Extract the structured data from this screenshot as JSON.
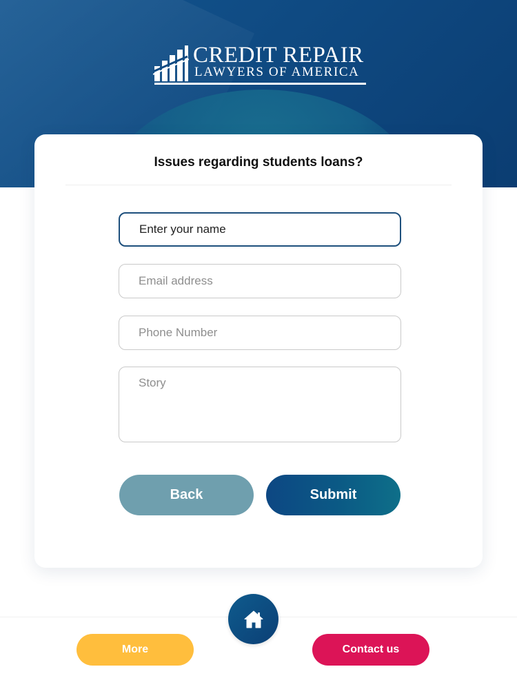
{
  "brand": {
    "line1": "CREDIT REPAIR",
    "line2": "LAWYERS OF AMERICA"
  },
  "form": {
    "title": "Issues regarding students loans?",
    "name_placeholder": "Enter your name",
    "email_placeholder": "Email address",
    "phone_placeholder": "Phone Number",
    "story_placeholder": "Story",
    "back_label": "Back",
    "submit_label": "Submit"
  },
  "bottom_nav": {
    "home_icon": "home-icon",
    "more_label": "More",
    "contact_label": "Contact us"
  },
  "colors": {
    "header_blue": "#0f4a82",
    "back_button": "#6f9fae",
    "submit_button": "#0d4783",
    "more_pill": "#ffbe3d",
    "contact_pill": "#dc1457"
  }
}
